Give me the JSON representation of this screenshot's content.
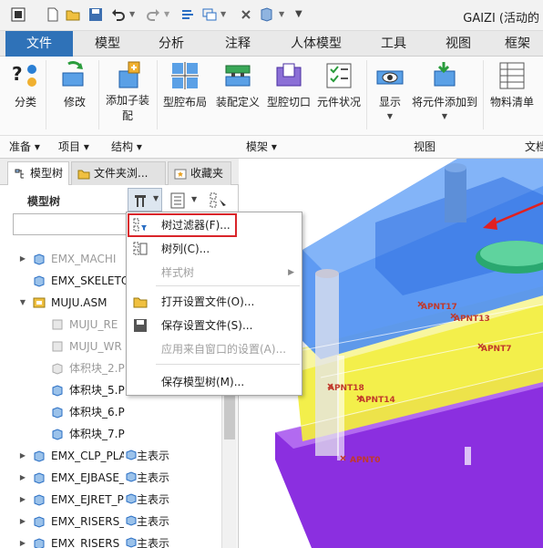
{
  "window": {
    "title": "GAIZI (活动的"
  },
  "tabs": [
    "文件",
    "模型",
    "分析",
    "注释",
    "人体模型",
    "工具",
    "视图",
    "框架"
  ],
  "ribbon": {
    "buttons": [
      {
        "label": "分类",
        "icon": "classify-icon"
      },
      {
        "label": "修改",
        "icon": "modify-icon"
      },
      {
        "label": "添加子装",
        "label2": "配",
        "icon": "add-subassembly-icon"
      },
      {
        "label": "型腔布局",
        "icon": "cavity-layout-icon"
      },
      {
        "label": "装配定义",
        "icon": "assembly-define-icon"
      },
      {
        "label": "型腔切口",
        "icon": "cavity-cut-icon"
      },
      {
        "label": "元件状况",
        "icon": "component-status-icon"
      },
      {
        "label": "显示",
        "icon": "display-icon"
      },
      {
        "label": "将元件添加到",
        "icon": "add-component-icon"
      },
      {
        "label": "物料清单",
        "icon": "bom-icon"
      }
    ],
    "groups": [
      "准备",
      "项目",
      "结构",
      "模架",
      "视图",
      "文档"
    ]
  },
  "panel": {
    "tabs": [
      "模型树",
      "文件夹浏...",
      "收藏夹"
    ],
    "title": "模型树",
    "tree": [
      {
        "text": "EMX_MACHI",
        "dim": false
      },
      {
        "text": "EMX_SKELETO",
        "dim": false
      },
      {
        "text": "MUJU.ASM",
        "dim": false
      },
      {
        "text": "MUJU_RE",
        "dim": true
      },
      {
        "text": "MUJU_WR",
        "dim": true
      },
      {
        "text": "体积块_2.P",
        "dim": true
      },
      {
        "text": "体积块_5.P",
        "dim": false
      },
      {
        "text": "体积块_6.P",
        "dim": false
      },
      {
        "text": "体积块_7.P",
        "dim": false
      },
      {
        "text": "EMX_CLP_PLA",
        "status": "主表示"
      },
      {
        "text": "EMX_EJBASE_",
        "status": "主表示"
      },
      {
        "text": "EMX_EJRET_P",
        "status": "主表示"
      },
      {
        "text": "EMX_RISERS_",
        "status": "主表示"
      },
      {
        "text": "EMX_RISERS_",
        "status": "主表示"
      }
    ]
  },
  "menu": {
    "items": [
      {
        "label": "树过滤器(F)...",
        "disabled": false
      },
      {
        "label": "树列(C)...",
        "disabled": false
      },
      {
        "label": "样式树",
        "disabled": true
      },
      {
        "label": "打开设置文件(O)...",
        "disabled": false
      },
      {
        "label": "保存设置文件(S)...",
        "disabled": false
      },
      {
        "label": "应用来自窗口的设置(A)...",
        "disabled": true
      },
      {
        "label": "保存模型树(M)...",
        "disabled": false
      }
    ]
  },
  "view": {
    "points": [
      "APNT17",
      "APNT13",
      "APNT7",
      "APNT18",
      "APNT14",
      "APNT0"
    ]
  },
  "colors": {
    "accent": "#2f72b8",
    "highlight": "#d9252a",
    "mold_blue": "#4d8ff2",
    "mold_yellow": "#f2ee3c",
    "mold_purple": "#8b2fe0"
  }
}
